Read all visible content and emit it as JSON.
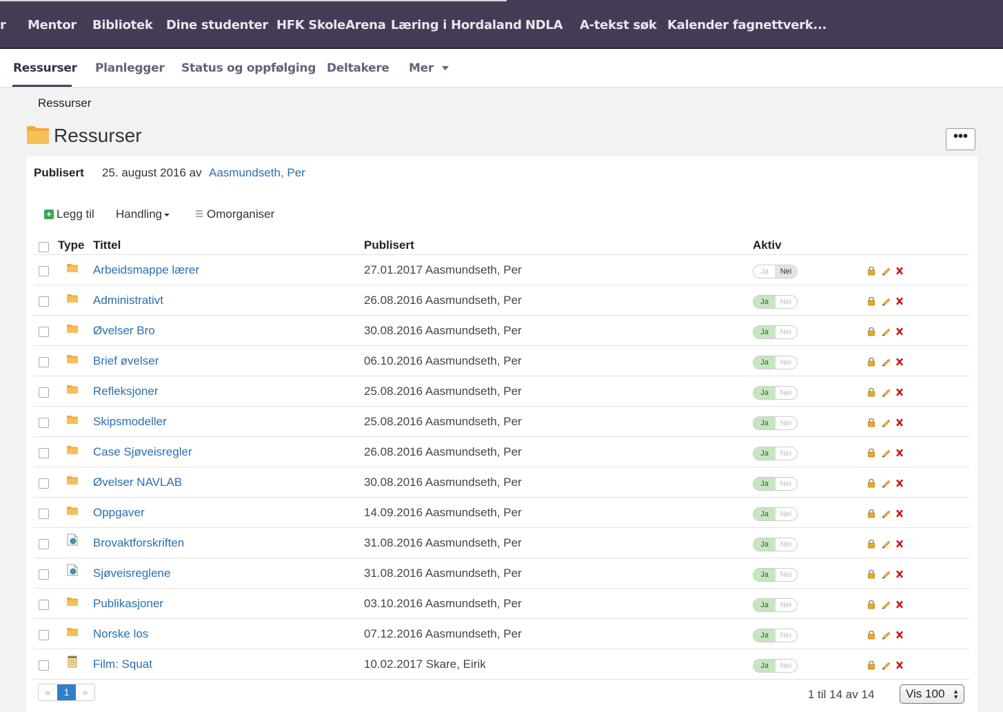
{
  "topnav": {
    "items": [
      "r",
      "Mentor",
      "Bibliotek",
      "Dine studenter",
      "HFK SkoleArena",
      "Læring i Hordaland",
      "NDLA",
      "A-tekst søk",
      "Kalender fagnettverk..."
    ]
  },
  "subnav": {
    "tabs": [
      "Ressurser",
      "Planlegger",
      "Status og oppfølging",
      "Deltakere",
      "Mer"
    ],
    "active": "Ressurser"
  },
  "breadcrumb": "Ressurser",
  "page": {
    "title": "Ressurser",
    "more_button": "•••",
    "published_label": "Publisert",
    "published_date": "25. august 2016 av",
    "published_author": "Aasmundseth, Per"
  },
  "toolbar": {
    "add_label": "Legg til",
    "action_label": "Handling",
    "reorganize_label": "Omorganiser"
  },
  "table": {
    "headers": {
      "type": "Type",
      "title": "Tittel",
      "published": "Publisert",
      "active": "Aktiv"
    },
    "toggle_labels": {
      "on": "Ja",
      "off": "Nei"
    },
    "rows": [
      {
        "type": "folder",
        "title": "Arbeidsmappe lærer",
        "published": "27.01.2017 Aasmundseth, Per",
        "active": false
      },
      {
        "type": "folder",
        "title": "Administrativt",
        "published": "26.08.2016 Aasmundseth, Per",
        "active": true
      },
      {
        "type": "folder",
        "title": "Øvelser Bro",
        "published": "30.08.2016 Aasmundseth, Per",
        "active": true
      },
      {
        "type": "folder",
        "title": "Brief øvelser",
        "published": "06.10.2016 Aasmundseth, Per",
        "active": true
      },
      {
        "type": "folder",
        "title": "Refleksjoner",
        "published": "25.08.2016 Aasmundseth, Per",
        "active": true
      },
      {
        "type": "folder",
        "title": "Skipsmodeller",
        "published": "25.08.2016 Aasmundseth, Per",
        "active": true
      },
      {
        "type": "folder",
        "title": "Case Sjøveisregler",
        "published": "26.08.2016 Aasmundseth, Per",
        "active": true
      },
      {
        "type": "folder",
        "title": "Øvelser NAVLAB",
        "published": "30.08.2016 Aasmundseth, Per",
        "active": true
      },
      {
        "type": "folder",
        "title": "Oppgaver",
        "published": "14.09.2016 Aasmundseth, Per",
        "active": true
      },
      {
        "type": "weblink",
        "title": "Brovaktforskriften",
        "published": "31.08.2016 Aasmundseth, Per",
        "active": true
      },
      {
        "type": "weblink",
        "title": "Sjøveisreglene",
        "published": "31.08.2016 Aasmundseth, Per",
        "active": true
      },
      {
        "type": "folder",
        "title": "Publikasjoner",
        "published": "03.10.2016 Aasmundseth, Per",
        "active": true
      },
      {
        "type": "folder",
        "title": "Norske los",
        "published": "07.12.2016 Aasmundseth, Per",
        "active": true
      },
      {
        "type": "document",
        "title": "Film: Squat",
        "published": "10.02.2017 Skare, Eirik",
        "active": true
      }
    ]
  },
  "pagination": {
    "prev": "«",
    "current": "1",
    "next": "»",
    "info": "1 til 14 av 14",
    "page_size": "Vis 100"
  },
  "colors": {
    "topnav_bg": "#443c55",
    "link": "#2a6fb0",
    "folder": "#f5b652",
    "toggle_on": "#c6e5c0",
    "delete": "#cc1111"
  }
}
